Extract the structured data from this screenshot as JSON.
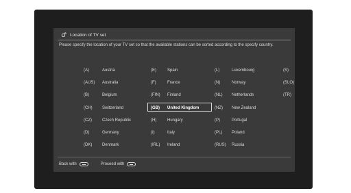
{
  "title": "Location of TV set",
  "description": "Please specify the location of your TV set so that the available stations can be sorted according to the specify country.",
  "columns": [
    [
      {
        "code": "(A)",
        "name": "Austria"
      },
      {
        "code": "(AUS)",
        "name": "Australia"
      },
      {
        "code": "(B)",
        "name": "Belgium"
      },
      {
        "code": "(CH)",
        "name": "Switzerland"
      },
      {
        "code": "(CZ)",
        "name": "Czech Republic"
      },
      {
        "code": "(D)",
        "name": "Germany"
      },
      {
        "code": "(DK)",
        "name": "Denmark"
      }
    ],
    [
      {
        "code": "(E)",
        "name": "Spain"
      },
      {
        "code": "(F)",
        "name": "France"
      },
      {
        "code": "(FIN)",
        "name": "Finland"
      },
      {
        "code": "(GB)",
        "name": "United Kingdom"
      },
      {
        "code": "(H)",
        "name": "Hungary"
      },
      {
        "code": "(I)",
        "name": "Italy"
      },
      {
        "code": "(IRL)",
        "name": "Ireland"
      }
    ],
    [
      {
        "code": "(L)",
        "name": "Luxembourg"
      },
      {
        "code": "(N)",
        "name": "Norway"
      },
      {
        "code": "(NL)",
        "name": "Netherlands"
      },
      {
        "code": "(NZ)",
        "name": "New Zealand"
      },
      {
        "code": "(P)",
        "name": "Portugal"
      },
      {
        "code": "(PL)",
        "name": "Poland"
      },
      {
        "code": "(RUS)",
        "name": "Russia"
      }
    ],
    [
      {
        "code": "(S)",
        "name": ""
      },
      {
        "code": "(SLO)",
        "name": ""
      },
      {
        "code": "(TR)",
        "name": ""
      }
    ]
  ],
  "selected": {
    "code": "(GB)",
    "name": "United Kingdom"
  },
  "footer": {
    "back_label": "Back with",
    "proceed_label": "Proceed with"
  },
  "colors": {
    "frame": "#1e1e1e",
    "panel": "#3a3a3a",
    "text": "#dcdcdc",
    "selection_border": "#d8d8d8"
  }
}
